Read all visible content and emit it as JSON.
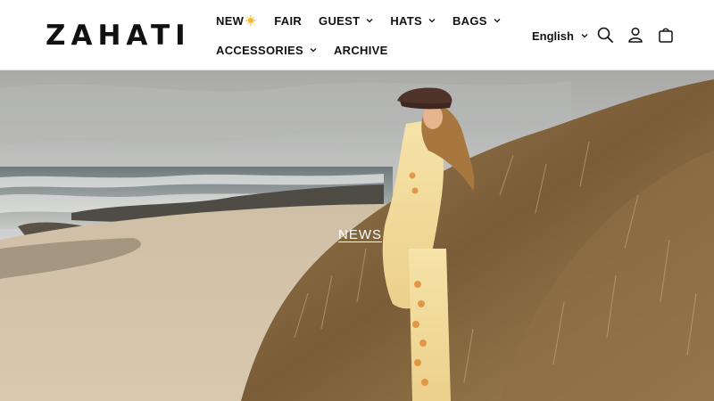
{
  "brand": {
    "name": "ZAHATI"
  },
  "nav": {
    "row1": [
      {
        "label": "NEW",
        "icon": "sun-emoji-icon",
        "dropdown": false
      },
      {
        "label": "FAIR",
        "dropdown": false
      },
      {
        "label": "GUEST",
        "dropdown": true
      },
      {
        "label": "HATS",
        "dropdown": true
      },
      {
        "label": "BAGS",
        "dropdown": true
      }
    ],
    "row2": [
      {
        "label": "ACCESSORIES",
        "dropdown": true
      },
      {
        "label": "ARCHIVE",
        "dropdown": false
      }
    ]
  },
  "header_tools": {
    "language": "English",
    "icons": [
      "search-icon",
      "account-icon",
      "cart-icon"
    ]
  },
  "hero": {
    "link_label": "NEWS"
  },
  "colors": {
    "text": "#111111",
    "header_bg": "#ffffff",
    "hero_link": "#ffffff"
  }
}
